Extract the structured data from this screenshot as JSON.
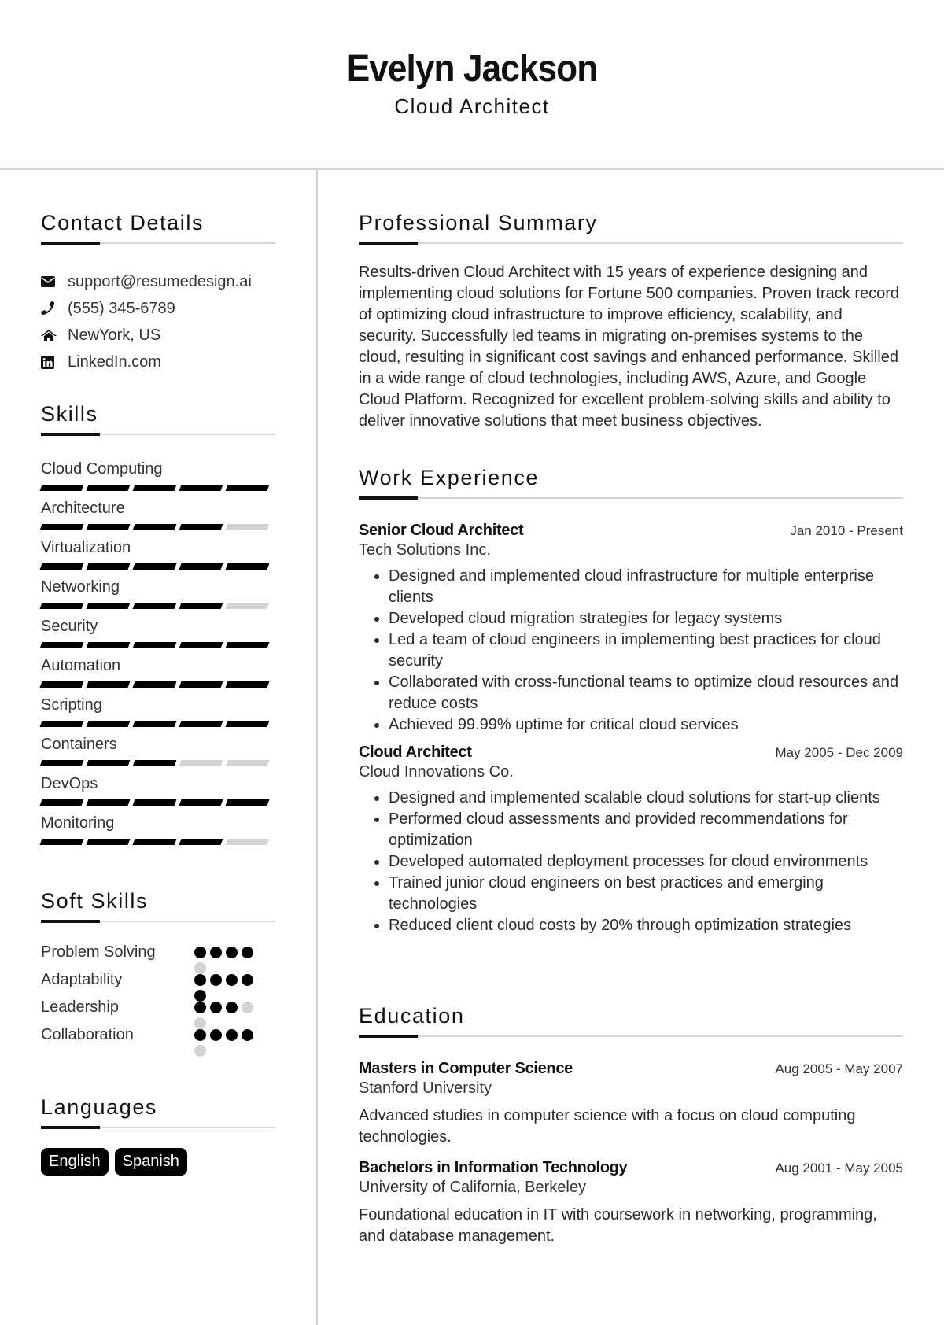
{
  "header": {
    "name": "Evelyn Jackson",
    "title": "Cloud Architect"
  },
  "contact": {
    "heading": "Contact Details",
    "items": [
      {
        "icon": "envelope-icon",
        "text": "support@resumedesign.ai"
      },
      {
        "icon": "phone-icon",
        "text": "(555) 345-6789"
      },
      {
        "icon": "home-icon",
        "text": "NewYork, US"
      },
      {
        "icon": "linkedin-icon",
        "text": "LinkedIn.com"
      }
    ]
  },
  "skills": {
    "heading": "Skills",
    "max": 5,
    "items": [
      {
        "name": "Cloud Computing",
        "level": 5
      },
      {
        "name": "Architecture",
        "level": 4
      },
      {
        "name": "Virtualization",
        "level": 5
      },
      {
        "name": "Networking",
        "level": 4
      },
      {
        "name": "Security",
        "level": 5
      },
      {
        "name": "Automation",
        "level": 5
      },
      {
        "name": "Scripting",
        "level": 5
      },
      {
        "name": "Containers",
        "level": 3
      },
      {
        "name": "DevOps",
        "level": 5
      },
      {
        "name": "Monitoring",
        "level": 4
      }
    ]
  },
  "soft_skills": {
    "heading": "Soft Skills",
    "max": 5,
    "items": [
      {
        "name": "Problem Solving",
        "level": 4
      },
      {
        "name": "Adaptability",
        "level": 5
      },
      {
        "name": "Leadership",
        "level": 3
      },
      {
        "name": "Collaboration",
        "level": 4
      }
    ]
  },
  "languages": {
    "heading": "Languages",
    "items": [
      "English",
      "Spanish"
    ]
  },
  "summary": {
    "heading": "Professional Summary",
    "text": "Results-driven Cloud Architect with 15 years of experience designing and implementing cloud solutions for Fortune 500 companies. Proven track record of optimizing cloud infrastructure to improve efficiency, scalability, and security. Successfully led teams in migrating on-premises systems to the cloud, resulting in significant cost savings and enhanced performance. Skilled in a wide range of cloud technologies, including AWS, Azure, and Google Cloud Platform. Recognized for excellent problem-solving skills and ability to deliver innovative solutions that meet business objectives."
  },
  "experience": {
    "heading": "Work Experience",
    "jobs": [
      {
        "title": "Senior Cloud Architect",
        "dates": "Jan 2010 - Present",
        "company": "Tech Solutions Inc.",
        "bullets": [
          "Designed and implemented cloud infrastructure for multiple enterprise clients",
          "Developed cloud migration strategies for legacy systems",
          "Led a team of cloud engineers in implementing best practices for cloud security",
          "Collaborated with cross-functional teams to optimize cloud resources and reduce costs",
          "Achieved 99.99% uptime for critical cloud services"
        ]
      },
      {
        "title": "Cloud Architect",
        "dates": "May 2005 - Dec 2009",
        "company": "Cloud Innovations Co.",
        "bullets": [
          "Designed and implemented scalable cloud solutions for start-up clients",
          "Performed cloud assessments and provided recommendations for optimization",
          "Developed automated deployment processes for cloud environments",
          "Trained junior cloud engineers on best practices and emerging technologies",
          "Reduced client cloud costs by 20% through optimization strategies"
        ]
      }
    ]
  },
  "education": {
    "heading": "Education",
    "items": [
      {
        "degree": "Masters in Computer Science",
        "dates": "Aug 2005 - May 2007",
        "school": "Stanford University",
        "description": "Advanced studies in computer science with a focus on cloud computing technologies."
      },
      {
        "degree": "Bachelors in Information Technology",
        "dates": "Aug 2001 - May 2005",
        "school": "University of California, Berkeley",
        "description": "Foundational education in IT with coursework in networking, programming, and database management."
      }
    ]
  }
}
